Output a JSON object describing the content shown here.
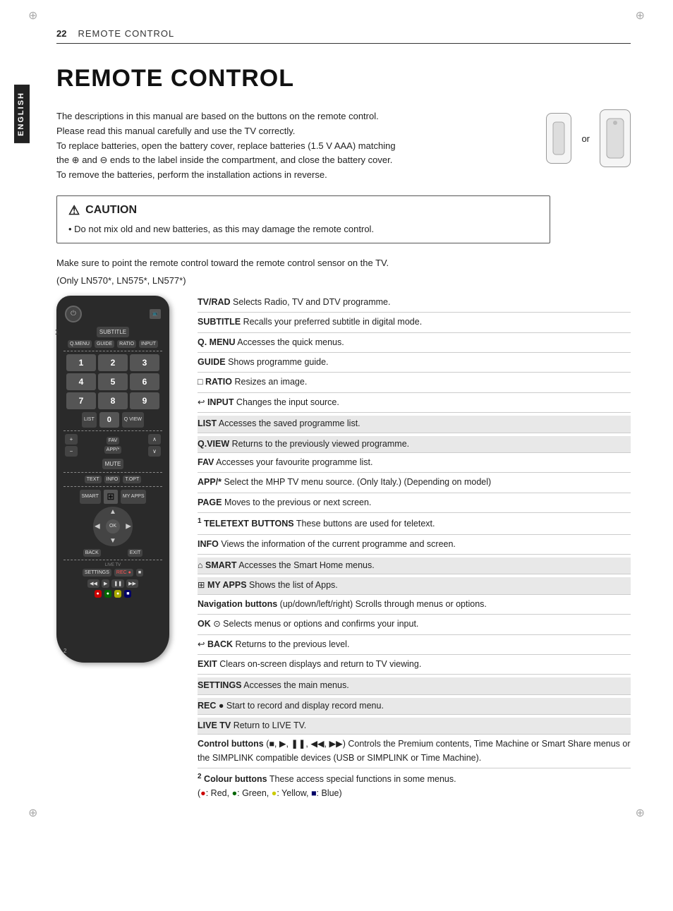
{
  "page": {
    "number": "22",
    "section_title": "REMOTE CONTROL",
    "main_title": "REMOTE CONTROL",
    "lang_tab": "ENGLISH",
    "intro": [
      "The descriptions in this manual are based on the buttons on the remote control.",
      "Please read this manual carefully and use the TV correctly.",
      "To replace batteries, open the battery cover, replace batteries (1.5 V AAA) matching",
      "the ⊕ and ⊖ ends to the label inside the compartment, and close the battery cover.",
      "To remove the batteries, perform the installation actions in reverse."
    ],
    "caution_title": "CAUTION",
    "caution_bullet": "Do not mix old and new batteries, as this may damage the remote control.",
    "note": "Make sure to point the remote control toward the remote control sensor on the TV.",
    "models": "(Only LN570*, LN575*, LN577*)"
  },
  "descriptions": [
    {
      "bold": "TV/RAD",
      "text": " Selects Radio, TV and DTV programme."
    },
    {
      "bold": "SUBTITLE",
      "text": " Recalls your preferred subtitle in digital mode."
    },
    {
      "bold": "Q. MENU",
      "text": " Accesses the quick menus."
    },
    {
      "bold": "GUIDE",
      "text": " Shows programme guide."
    },
    {
      "bold": "RATIO",
      "text": " Resizes an image."
    },
    {
      "bold": "INPUT",
      "text": " Changes the input source."
    },
    {
      "bold": "LIST",
      "text": " Accesses the saved  programme list."
    },
    {
      "bold": "Q.VIEW",
      "text": " Returns to the previously viewed programme."
    },
    {
      "bold": "FAV",
      "text": " Accesses your favourite programme list."
    },
    {
      "bold": "APP/*",
      "text": " Select the MHP TV menu source. (Only Italy.) (Depending on model)"
    },
    {
      "bold": "PAGE",
      "text": " Moves to the previous or next screen."
    },
    {
      "bold": "1 TELETEXT BUTTONS",
      "text": " These buttons are used for teletext."
    },
    {
      "bold": "INFO",
      "text": " Views the information of the current programme and screen."
    },
    {
      "bold": "SMART",
      "text": " Accesses the Smart Home menus."
    },
    {
      "bold": "MY APPS",
      "text": " Shows the list of Apps."
    },
    {
      "bold": "Navigation buttons",
      "text": " (up/down/left/right) Scrolls through menus or options."
    },
    {
      "bold": "OK",
      "text": " Selects menus or options and confirms your input."
    },
    {
      "bold": "BACK",
      "text": " Returns to the previous level."
    },
    {
      "bold": "EXIT",
      "text": " Clears on-screen displays and return to TV viewing."
    },
    {
      "bold": "SETTINGS",
      "text": " Accesses the main menus."
    },
    {
      "bold": "REC ●",
      "text": " Start to record and display record menu."
    },
    {
      "bold": "LIVE TV",
      "text": " Return to LIVE TV."
    },
    {
      "bold": "Control buttons",
      "text": " (■, ▶, ❚❚, ◀◀, ▶▶) Controls the Premium contents, Time Machine or Smart Share menus or the SIMPLINK compatible devices (USB or SIMPLINK or Time Machine)."
    },
    {
      "bold": "2 Colour buttons",
      "text": " These access special functions in some menus.\n(●: Red, ●: Green, ●: Yellow, ■: Blue)"
    }
  ],
  "remote": {
    "num1_label": "1",
    "num2_label": "2",
    "buttons": {
      "power": "⏻",
      "subtitle": "SUBTITLE",
      "qmenu": "Q.MENU",
      "guide": "GUIDE",
      "ratio": "RATIO",
      "input": "INPUT",
      "nums": [
        "1",
        "2",
        "3",
        "4",
        "5",
        "6",
        "7",
        "8",
        "9"
      ],
      "list": "LIST",
      "zero": "0",
      "qview": "Q VIEW",
      "plus": "+",
      "minus": "−",
      "fav": "FAV",
      "app": "APP/*",
      "page_up": "∧",
      "page_dn": "∨",
      "mute": "MUTE",
      "text": "TEXT",
      "info": "INFO",
      "topt": "T.OPT",
      "smart": "SMART",
      "myapps": "MY APPS",
      "left": "◀",
      "right": "▶",
      "up": "▲",
      "down": "▼",
      "ok": "OK",
      "back": "BACK",
      "exit": "EXIT",
      "settings": "SETTINGS",
      "rec": "REC ●",
      "stop": "■",
      "rew": "◀◀",
      "play": "▶",
      "pause": "❚❚",
      "fwd": "▶▶",
      "live_tv": "LIVE TV"
    }
  }
}
